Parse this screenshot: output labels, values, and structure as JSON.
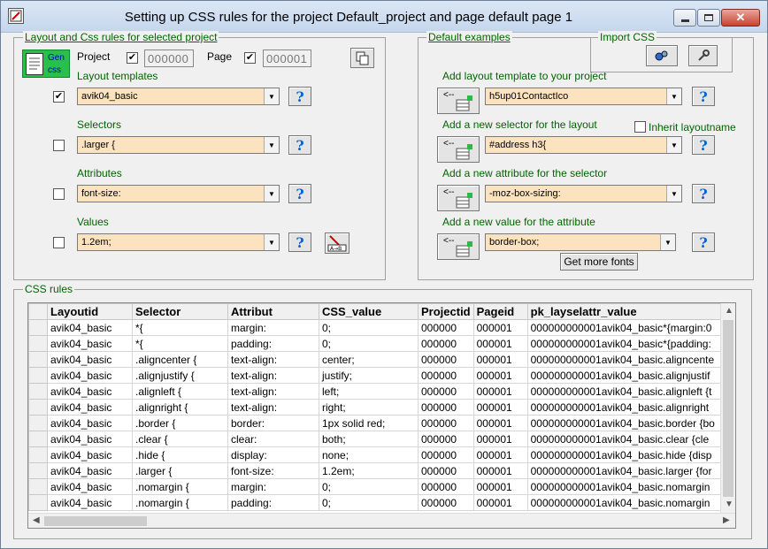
{
  "window": {
    "title": "Setting up CSS rules for the project Default_project and page default page 1"
  },
  "left_panel": {
    "legend": "Layout and Css rules for selected project",
    "gen_css_label_1": "Gen",
    "gen_css_label_2": "css",
    "project_label": "Project",
    "project_checked": true,
    "project_value": "000000",
    "page_label": "Page",
    "page_checked": true,
    "page_value": "000001",
    "layout_templates_label": "Layout templates",
    "layout_checked": true,
    "layout_value": "avik04_basic",
    "selectors_label": "Selectors",
    "selector_checked": false,
    "selector_value": ".larger {",
    "attributes_label": "Attributes",
    "attribute_checked": false,
    "attribute_value": "font-size:",
    "values_label": "Values",
    "value_checked": false,
    "value_value": "1.2em;"
  },
  "right_panel": {
    "legend": "Default examples",
    "import_legend": "Import CSS",
    "add_layout_label": "Add layout template to your project",
    "layout_value": "h5up01ContactIco",
    "add_selector_label": "Add a new selector for the layout",
    "inherit_label": "Inherit layoutname",
    "inherit_checked": false,
    "selector_value": "#address h3{",
    "add_attribute_label": "Add a new attribute for the selector",
    "attribute_value": "-moz-box-sizing:",
    "add_value_label": "Add a new value for the attribute",
    "value_value": "border-box;",
    "more_fonts_label": "Get more fonts",
    "add_button_text": "<--"
  },
  "css_rules": {
    "legend": "CSS rules",
    "columns": [
      "Layoutid",
      "Selector",
      "Attribut",
      "CSS_value",
      "Projectid",
      "Pageid",
      "pk_layselattr_value"
    ],
    "rows": [
      [
        "avik04_basic",
        "*{",
        "margin:",
        "0;",
        "000000",
        "000001",
        "000000000001avik04_basic*{margin:0"
      ],
      [
        "avik04_basic",
        "*{",
        "padding:",
        "0;",
        "000000",
        "000001",
        "000000000001avik04_basic*{padding:"
      ],
      [
        "avik04_basic",
        ".aligncenter {",
        "text-align:",
        "center;",
        "000000",
        "000001",
        "000000000001avik04_basic.aligncente"
      ],
      [
        "avik04_basic",
        ".alignjustify {",
        "text-align:",
        "justify;",
        "000000",
        "000001",
        "000000000001avik04_basic.alignjustif"
      ],
      [
        "avik04_basic",
        ".alignleft {",
        "text-align:",
        "left;",
        "000000",
        "000001",
        "000000000001avik04_basic.alignleft {t"
      ],
      [
        "avik04_basic",
        ".alignright {",
        "text-align:",
        "right;",
        "000000",
        "000001",
        "000000000001avik04_basic.alignright"
      ],
      [
        "avik04_basic",
        ".border {",
        "border:",
        "1px solid red;",
        "000000",
        "000001",
        "000000000001avik04_basic.border {bo"
      ],
      [
        "avik04_basic",
        ".clear {",
        "clear:",
        "both;",
        "000000",
        "000001",
        "000000000001avik04_basic.clear {cle"
      ],
      [
        "avik04_basic",
        ".hide {",
        "display:",
        "none;",
        "000000",
        "000001",
        "000000000001avik04_basic.hide {disp"
      ],
      [
        "avik04_basic",
        ".larger {",
        "font-size:",
        "1.2em;",
        "000000",
        "000001",
        "000000000001avik04_basic.larger {for"
      ],
      [
        "avik04_basic",
        ".nomargin {",
        "margin:",
        "0;",
        "000000",
        "000001",
        "000000000001avik04_basic.nomargin"
      ],
      [
        "avik04_basic",
        ".nomargin {",
        "padding:",
        "0;",
        "000000",
        "000001",
        "000000000001avik04_basic.nomargin"
      ]
    ]
  },
  "colors": {
    "label_green": "#006400",
    "combo_bg": "#fbe3bf",
    "help_blue": "#0a64c8",
    "gen_css_green": "#26c04a"
  }
}
